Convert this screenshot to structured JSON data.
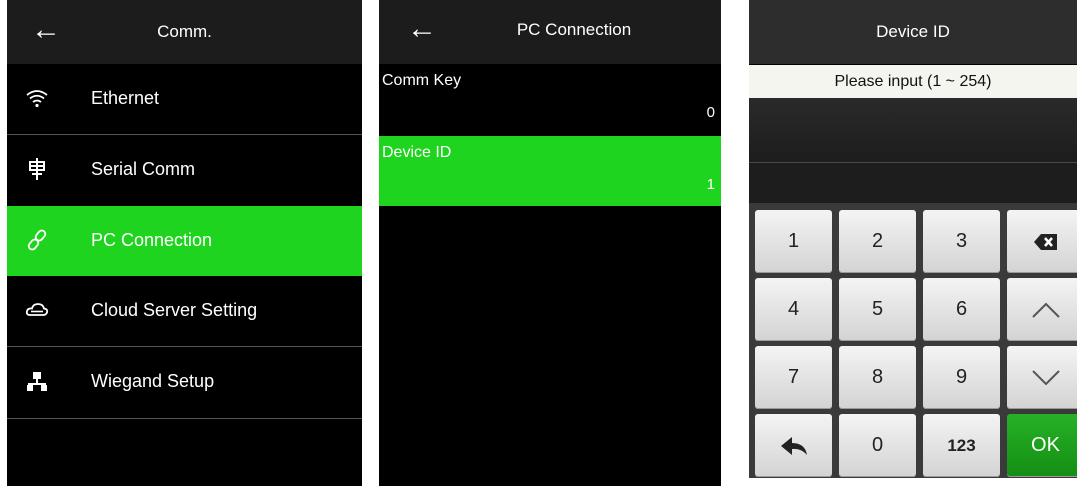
{
  "comm_screen": {
    "title": "Comm.",
    "items": [
      {
        "label": "Ethernet",
        "icon": "wifi-icon"
      },
      {
        "label": "Serial Comm",
        "icon": "serial-icon"
      },
      {
        "label": "PC Connection",
        "icon": "link-icon",
        "selected": true
      },
      {
        "label": "Cloud Server Setting",
        "icon": "cloud-icon"
      },
      {
        "label": "Wiegand Setup",
        "icon": "network-icon"
      }
    ]
  },
  "pc_connection_screen": {
    "title": "PC Connection",
    "fields": [
      {
        "label": "Comm Key",
        "value": "0"
      },
      {
        "label": "Device ID",
        "value": "1",
        "selected": true
      }
    ]
  },
  "device_id_screen": {
    "title": "Device ID",
    "prompt": "Please input (1 ~ 254)",
    "keys": {
      "k1": "1",
      "k2": "2",
      "k3": "3",
      "k4": "4",
      "k5": "5",
      "k6": "6",
      "k7": "7",
      "k8": "8",
      "k9": "9",
      "k0": "0",
      "mode": "123",
      "ok": "OK"
    }
  },
  "colors": {
    "accent_green": "#1fd41f",
    "ok_green": "#1a9e1a",
    "background": "#000000"
  }
}
